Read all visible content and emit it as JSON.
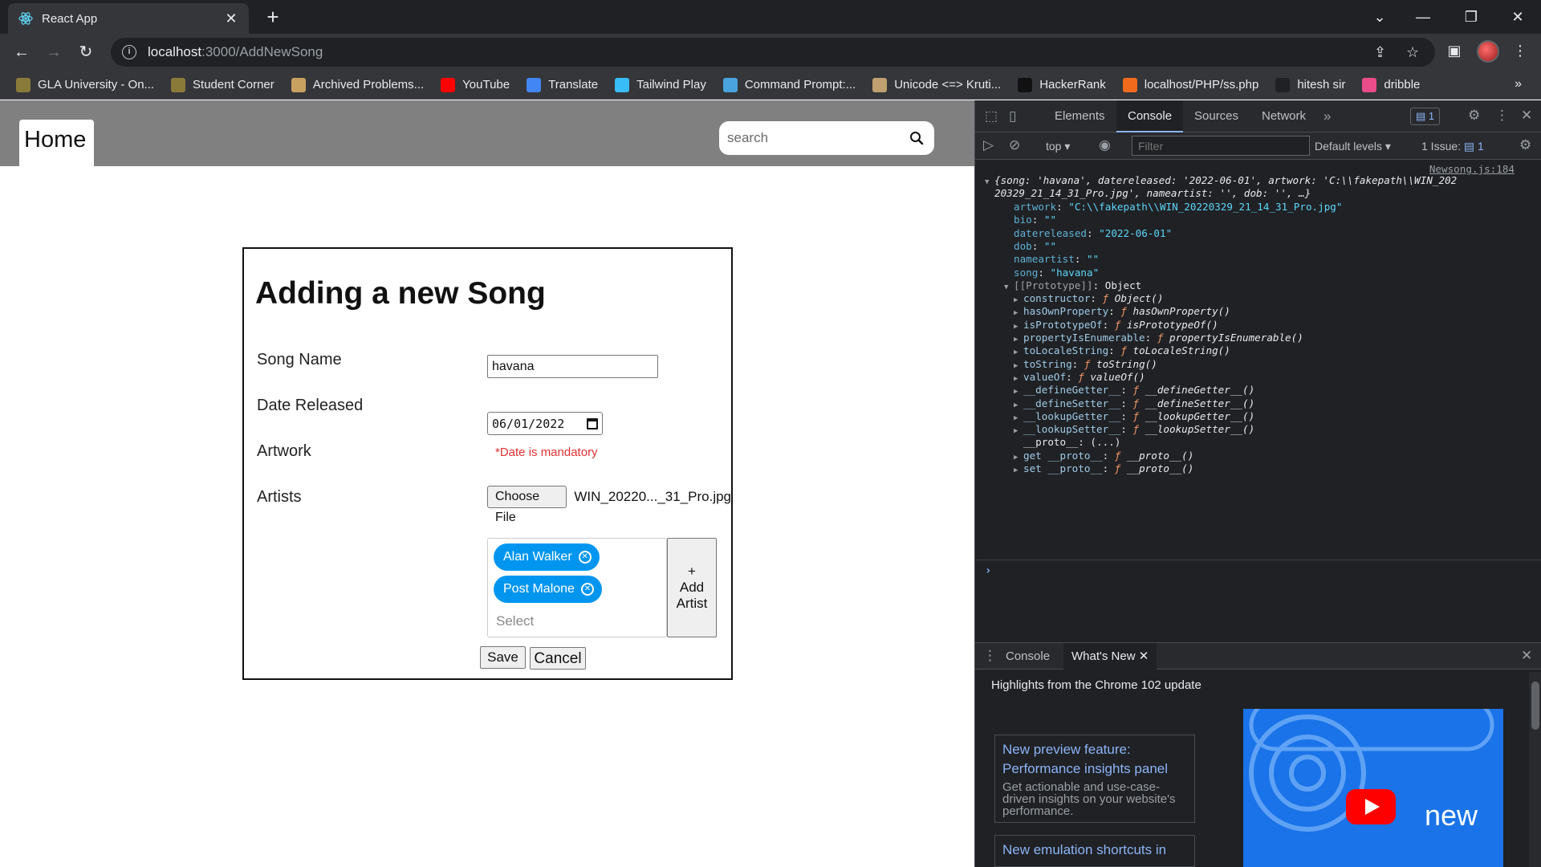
{
  "browser": {
    "tab_title": "React App",
    "tab_close": "✕",
    "new_tab": "+",
    "url_host": "localhost",
    "url_path": ":3000/AddNewSong",
    "bookmarks": [
      {
        "label": "GLA University - On...",
        "icon": "gla-icon",
        "color": "#8a7a3a"
      },
      {
        "label": "Student Corner",
        "icon": "gla-icon",
        "color": "#8a7a3a"
      },
      {
        "label": "Archived Problems...",
        "icon": "archive-icon",
        "color": "#c8a060"
      },
      {
        "label": "YouTube",
        "icon": "youtube-icon",
        "color": "#ff0000"
      },
      {
        "label": "Translate",
        "icon": "translate-icon",
        "color": "#4285f4"
      },
      {
        "label": "Tailwind Play",
        "icon": "tailwind-icon",
        "color": "#38bdf8"
      },
      {
        "label": "Command Prompt:...",
        "icon": "cross-icon",
        "color": "#4aa3df"
      },
      {
        "label": "Unicode <=> Kruti...",
        "icon": "unicode-icon",
        "color": "#c0a070"
      },
      {
        "label": "HackerRank",
        "icon": "hackerrank-icon",
        "color": "#111111"
      },
      {
        "label": "localhost/PHP/ss.php",
        "icon": "php-icon",
        "color": "#f26b1d"
      },
      {
        "label": "hitesh sir",
        "icon": "code-icon",
        "color": "#202124"
      },
      {
        "label": "dribble",
        "icon": "dribbble-icon",
        "color": "#ea4c89"
      }
    ]
  },
  "app": {
    "nav": {
      "home_label": "Home",
      "search_placeholder": "search"
    },
    "form": {
      "title": "Adding a new Song",
      "labels": {
        "song_name": "Song Name",
        "date_released": "Date Released",
        "artwork": "Artwork",
        "artists": "Artists"
      },
      "song_name_value": "havana",
      "date_value": "06/01/2022",
      "date_error": "*Date is mandatory",
      "choose_file_label": "Choose File",
      "file_name": "WIN_20220..._31_Pro.jpg",
      "artists_selected": [
        "Alan Walker",
        "Post Malone"
      ],
      "select_placeholder": "Select",
      "add_artist_label": [
        "+",
        "Add",
        "Artist"
      ],
      "save_label": "Save",
      "cancel_label": "Cancel"
    }
  },
  "devtools": {
    "tabs": [
      "Elements",
      "Console",
      "Sources",
      "Network"
    ],
    "active_tab": "Console",
    "messages_badge": "1",
    "context": "top",
    "filter_placeholder": "Filter",
    "levels": "Default levels",
    "issues": "1 Issue:",
    "issues_count": "1",
    "console": {
      "source": "Newsong.js:184",
      "summary_line1": "{song: 'havana', datereleased: '2022-06-01', artwork: 'C:\\\\fakepath\\\\WIN_202",
      "summary_line2": "20329_21_14_31_Pro.jpg', nameartist: '', dob: '', …}",
      "props": [
        {
          "key": "artwork",
          "value": "\"C:\\\\fakepath\\\\WIN_20220329_21_14_31_Pro.jpg\""
        },
        {
          "key": "bio",
          "value": "\"\""
        },
        {
          "key": "datereleased",
          "value": "\"2022-06-01\""
        },
        {
          "key": "dob",
          "value": "\"\""
        },
        {
          "key": "nameartist",
          "value": "\"\""
        },
        {
          "key": "song",
          "value": "\"havana\""
        }
      ],
      "prototype_key": "[[Prototype]]",
      "prototype_value": "Object",
      "proto_members": [
        {
          "key": "constructor",
          "value": "Object()"
        },
        {
          "key": "hasOwnProperty",
          "value": "hasOwnProperty()"
        },
        {
          "key": "isPrototypeOf",
          "value": "isPrototypeOf()"
        },
        {
          "key": "propertyIsEnumerable",
          "value": "propertyIsEnumerable()"
        },
        {
          "key": "toLocaleString",
          "value": "toLocaleString()"
        },
        {
          "key": "toString",
          "value": "toString()"
        },
        {
          "key": "valueOf",
          "value": "valueOf()"
        },
        {
          "key": "__defineGetter__",
          "value": "__defineGetter__()"
        },
        {
          "key": "__defineSetter__",
          "value": "__defineSetter__()"
        },
        {
          "key": "__lookupGetter__",
          "value": "__lookupGetter__()"
        },
        {
          "key": "__lookupSetter__",
          "value": "__lookupSetter__()"
        }
      ],
      "proto_accessor": "__proto__: (...)",
      "get_proto": {
        "key": "get __proto__",
        "value": "__proto__()"
      },
      "set_proto": {
        "key": "set __proto__",
        "value": "__proto__()"
      }
    },
    "drawer": {
      "tabs": [
        "Console",
        "What's New"
      ],
      "heading": "Highlights from the Chrome 102 update",
      "card1_title": "New preview feature:",
      "card1_link": "Performance insights panel",
      "card1_desc": "Get actionable and use-case-driven insights on your website's performance.",
      "card2_link": "New emulation shortcuts in",
      "video_label": "new"
    }
  }
}
